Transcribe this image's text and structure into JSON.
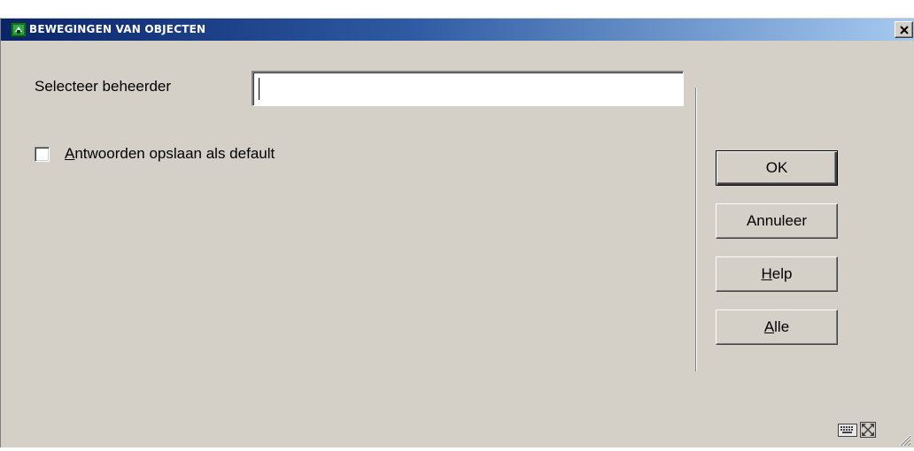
{
  "window": {
    "title": "BEWEGINGEN VAN OBJECTEN",
    "title_icon": "app-icon",
    "close_icon": "close-icon"
  },
  "form": {
    "beheerder_label": "Selecteer beheerder",
    "beheerder_value": "",
    "checkbox_label_accel": "A",
    "checkbox_label_rest": "ntwoorden opslaan als default",
    "checkbox_checked": false
  },
  "buttons": {
    "ok": "OK",
    "annuleer": "Annuleer",
    "help_accel": "H",
    "help_rest": "elp",
    "alle_accel": "A",
    "alle_rest": "lle"
  },
  "status": {
    "icons": [
      "keyboard-icon",
      "maximize-icon",
      "resize-grip-icon"
    ]
  }
}
